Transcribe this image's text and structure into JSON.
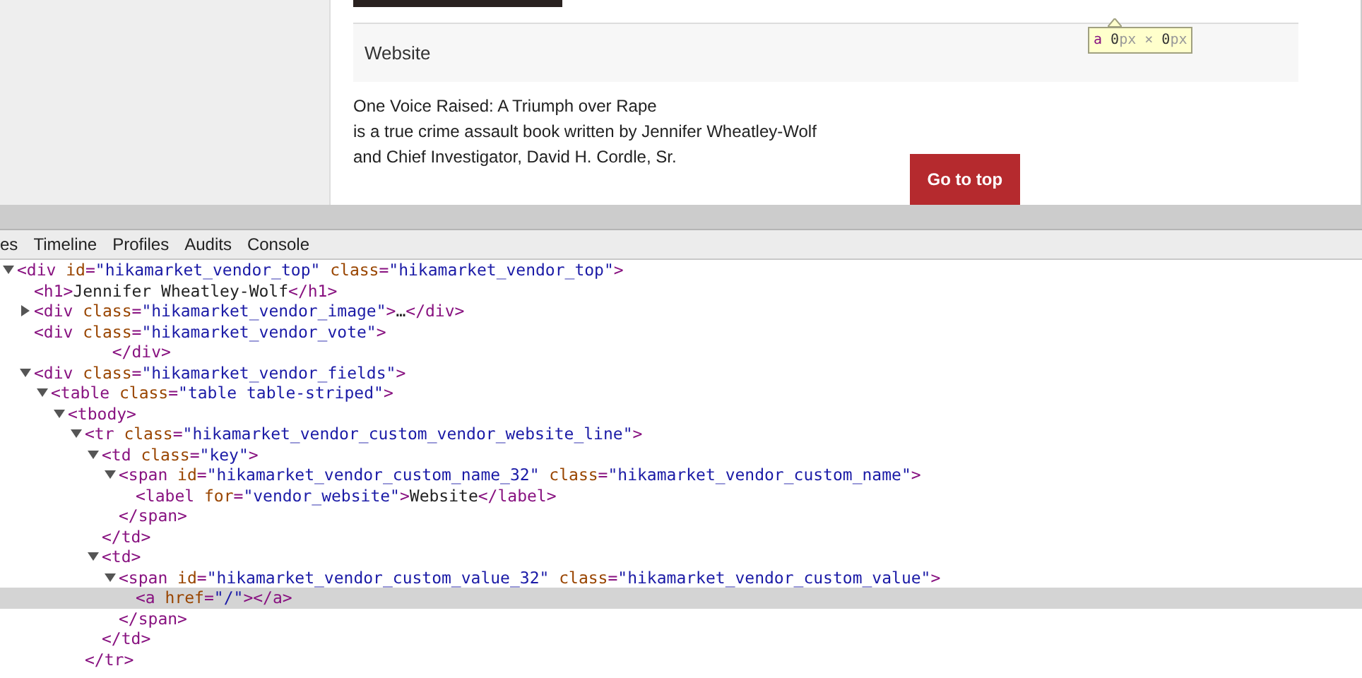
{
  "page": {
    "field_label": "Website",
    "description_lines": [
      "One Voice Raised: A Triumph over Rape",
      "is a true crime assault book written by Jennifer Wheatley-Wolf",
      "and Chief Investigator, David H. Cordle, Sr."
    ],
    "go_to_top": "Go to top",
    "tooltip": {
      "tag": "a",
      "size": [
        {
          "kind": "num",
          "text": "0"
        },
        {
          "kind": "unit",
          "text": "px"
        },
        {
          "kind": "unit",
          "text": " × "
        },
        {
          "kind": "num",
          "text": "0"
        },
        {
          "kind": "unit",
          "text": "px"
        }
      ]
    }
  },
  "devtools": {
    "tabs": [
      {
        "label": "es",
        "selected": false
      },
      {
        "label": "Timeline",
        "selected": false
      },
      {
        "label": "Profiles",
        "selected": false
      },
      {
        "label": "Audits",
        "selected": false
      },
      {
        "label": "Console",
        "selected": false
      }
    ],
    "dom_tree": {
      "expanded": true,
      "selected": false,
      "line": [
        {
          "kind": "tag",
          "text": "<div"
        },
        {
          "kind": "attr",
          "text": " id"
        },
        {
          "kind": "tag",
          "text": "="
        },
        {
          "kind": "value",
          "text": "\"hikamarket_vendor_top\""
        },
        {
          "kind": "attr",
          "text": " class"
        },
        {
          "kind": "tag",
          "text": "="
        },
        {
          "kind": "value",
          "text": "\"hikamarket_vendor_top\""
        },
        {
          "kind": "tag",
          "text": ">"
        }
      ],
      "children": [
        {
          "selected": false,
          "line": [
            {
              "kind": "tag",
              "text": "<h1>"
            },
            {
              "kind": "text",
              "text": "Jennifer Wheatley-Wolf"
            },
            {
              "kind": "tag",
              "text": "</h1>"
            }
          ]
        },
        {
          "expanded": false,
          "selected": false,
          "line": [
            {
              "kind": "tag",
              "text": "<div"
            },
            {
              "kind": "attr",
              "text": " class"
            },
            {
              "kind": "tag",
              "text": "="
            },
            {
              "kind": "value",
              "text": "\"hikamarket_vendor_image\""
            },
            {
              "kind": "tag",
              "text": ">"
            },
            {
              "kind": "text",
              "text": "…"
            },
            {
              "kind": "tag",
              "text": "</div>"
            }
          ]
        },
        {
          "selected": false,
          "line": [
            {
              "kind": "tag",
              "text": "<div"
            },
            {
              "kind": "attr",
              "text": " class"
            },
            {
              "kind": "tag",
              "text": "="
            },
            {
              "kind": "value",
              "text": "\"hikamarket_vendor_vote\""
            },
            {
              "kind": "tag",
              "text": ">"
            }
          ],
          "close": [
            {
              "kind": "tag",
              "text": "        </div>"
            }
          ]
        },
        {
          "expanded": true,
          "selected": false,
          "line": [
            {
              "kind": "tag",
              "text": "<div"
            },
            {
              "kind": "attr",
              "text": " class"
            },
            {
              "kind": "tag",
              "text": "="
            },
            {
              "kind": "value",
              "text": "\"hikamarket_vendor_fields\""
            },
            {
              "kind": "tag",
              "text": ">"
            }
          ],
          "children": [
            {
              "expanded": true,
              "selected": false,
              "line": [
                {
                  "kind": "tag",
                  "text": "<table"
                },
                {
                  "kind": "attr",
                  "text": " class"
                },
                {
                  "kind": "tag",
                  "text": "="
                },
                {
                  "kind": "value",
                  "text": "\"table table-striped\""
                },
                {
                  "kind": "tag",
                  "text": ">"
                }
              ],
              "children": [
                {
                  "expanded": true,
                  "selected": false,
                  "line": [
                    {
                      "kind": "tag",
                      "text": "<tbody>"
                    }
                  ],
                  "children": [
                    {
                      "expanded": true,
                      "selected": false,
                      "line": [
                        {
                          "kind": "tag",
                          "text": "<tr"
                        },
                        {
                          "kind": "attr",
                          "text": " class"
                        },
                        {
                          "kind": "tag",
                          "text": "="
                        },
                        {
                          "kind": "value",
                          "text": "\"hikamarket_vendor_custom_vendor_website_line\""
                        },
                        {
                          "kind": "tag",
                          "text": ">"
                        }
                      ],
                      "close": [
                        {
                          "kind": "tag",
                          "text": "</tr>"
                        }
                      ],
                      "children": [
                        {
                          "expanded": true,
                          "selected": false,
                          "line": [
                            {
                              "kind": "tag",
                              "text": "<td"
                            },
                            {
                              "kind": "attr",
                              "text": " class"
                            },
                            {
                              "kind": "tag",
                              "text": "="
                            },
                            {
                              "kind": "value",
                              "text": "\"key\""
                            },
                            {
                              "kind": "tag",
                              "text": ">"
                            }
                          ],
                          "close": [
                            {
                              "kind": "tag",
                              "text": "</td>"
                            }
                          ],
                          "children": [
                            {
                              "expanded": true,
                              "selected": false,
                              "line": [
                                {
                                  "kind": "tag",
                                  "text": "<span"
                                },
                                {
                                  "kind": "attr",
                                  "text": " id"
                                },
                                {
                                  "kind": "tag",
                                  "text": "="
                                },
                                {
                                  "kind": "value",
                                  "text": "\"hikamarket_vendor_custom_name_32\""
                                },
                                {
                                  "kind": "attr",
                                  "text": " class"
                                },
                                {
                                  "kind": "tag",
                                  "text": "="
                                },
                                {
                                  "kind": "value",
                                  "text": "\"hikamarket_vendor_custom_name\""
                                },
                                {
                                  "kind": "tag",
                                  "text": ">"
                                }
                              ],
                              "close": [
                                {
                                  "kind": "tag",
                                  "text": "</span>"
                                }
                              ],
                              "children": [
                                {
                                  "selected": false,
                                  "line": [
                                    {
                                      "kind": "tag",
                                      "text": "<label"
                                    },
                                    {
                                      "kind": "attr",
                                      "text": " for"
                                    },
                                    {
                                      "kind": "tag",
                                      "text": "="
                                    },
                                    {
                                      "kind": "value",
                                      "text": "\"vendor_website\""
                                    },
                                    {
                                      "kind": "tag",
                                      "text": ">"
                                    },
                                    {
                                      "kind": "text",
                                      "text": "Website"
                                    },
                                    {
                                      "kind": "tag",
                                      "text": "</label>"
                                    }
                                  ]
                                }
                              ]
                            }
                          ]
                        },
                        {
                          "expanded": true,
                          "selected": false,
                          "line": [
                            {
                              "kind": "tag",
                              "text": "<td>"
                            }
                          ],
                          "close": [
                            {
                              "kind": "tag",
                              "text": "</td>"
                            }
                          ],
                          "children": [
                            {
                              "expanded": true,
                              "selected": false,
                              "line": [
                                {
                                  "kind": "tag",
                                  "text": "<span"
                                },
                                {
                                  "kind": "attr",
                                  "text": " id"
                                },
                                {
                                  "kind": "tag",
                                  "text": "="
                                },
                                {
                                  "kind": "value",
                                  "text": "\"hikamarket_vendor_custom_value_32\""
                                },
                                {
                                  "kind": "attr",
                                  "text": " class"
                                },
                                {
                                  "kind": "tag",
                                  "text": "="
                                },
                                {
                                  "kind": "value",
                                  "text": "\"hikamarket_vendor_custom_value\""
                                },
                                {
                                  "kind": "tag",
                                  "text": ">"
                                }
                              ],
                              "close": [
                                {
                                  "kind": "tag",
                                  "text": "</span>"
                                }
                              ],
                              "children": [
                                {
                                  "selected": true,
                                  "line": [
                                    {
                                      "kind": "tag",
                                      "text": "<a"
                                    },
                                    {
                                      "kind": "attr",
                                      "text": " href"
                                    },
                                    {
                                      "kind": "tag",
                                      "text": "="
                                    },
                                    {
                                      "kind": "value",
                                      "text": "\"/\""
                                    },
                                    {
                                      "kind": "tag",
                                      "text": "></a>"
                                    }
                                  ]
                                }
                              ]
                            }
                          ]
                        }
                      ]
                    }
                  ]
                }
              ]
            }
          ]
        }
      ]
    }
  }
}
